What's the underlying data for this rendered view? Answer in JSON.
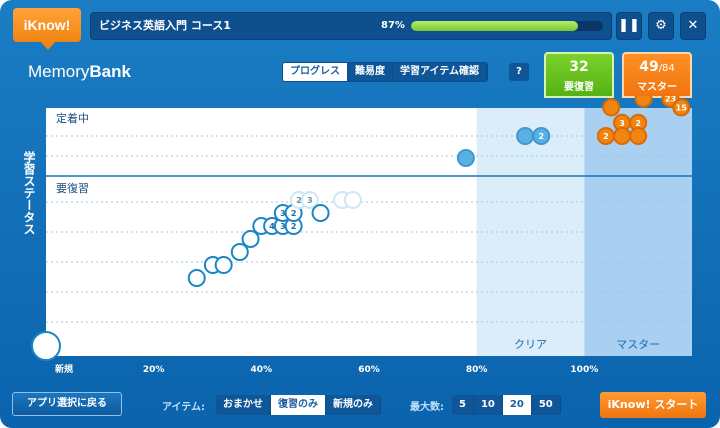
{
  "header": {
    "logo": "iKnow!",
    "course_title": "ビジネス英語入門 コース1",
    "progress_text": "87%",
    "progress_fraction": 0.87,
    "pause_icon": "pause-icon",
    "settings_icon": "gear-icon",
    "close_icon": "close-icon"
  },
  "panel": {
    "title_light": "Memory",
    "title_bold": "Bank",
    "tabs": [
      {
        "label": "プログレス",
        "active": true
      },
      {
        "label": "難易度",
        "active": false
      },
      {
        "label": "学習アイテム確認",
        "active": false
      }
    ],
    "help_label": "?",
    "review": {
      "count": "32",
      "label": "要復習"
    },
    "master": {
      "count": "49",
      "total": "/84",
      "label": "マスター"
    }
  },
  "chart_data": {
    "type": "scatter",
    "ylabel": "学習ステータス",
    "status_labels": [
      "定着中",
      "要復習"
    ],
    "x_ticks": [
      "新規",
      "20%",
      "40%",
      "60%",
      "80%",
      "100%"
    ],
    "zones": [
      {
        "label": "クリア",
        "from": 80,
        "to": 100
      },
      {
        "label": "マスター",
        "from": 100,
        "to": 120
      }
    ],
    "colors": {
      "plot_bg": "#ffffff",
      "clear_zone": "#dcedfa",
      "master_zone": "#a9d0f0",
      "review_ring": "#1a86c4",
      "review_faded": "#cfe6f6",
      "clear_point": "#5ab0e2",
      "master_point": "#f08512"
    },
    "points": [
      {
        "x": 0,
        "level": -6,
        "label": "",
        "style": "new"
      },
      {
        "x": 28,
        "level": -3.5,
        "label": "",
        "style": "review"
      },
      {
        "x": 31,
        "level": -3,
        "label": "",
        "style": "review"
      },
      {
        "x": 33,
        "level": -3,
        "label": "",
        "style": "review"
      },
      {
        "x": 36,
        "level": -2.5,
        "label": "",
        "style": "review"
      },
      {
        "x": 38,
        "level": -2,
        "label": "",
        "style": "review"
      },
      {
        "x": 40,
        "level": -1.5,
        "label": "",
        "style": "review"
      },
      {
        "x": 42,
        "level": -1.5,
        "label": "4",
        "style": "review"
      },
      {
        "x": 44,
        "level": -1.5,
        "label": "3",
        "style": "review"
      },
      {
        "x": 46,
        "level": -1.5,
        "label": "2",
        "style": "review"
      },
      {
        "x": 44,
        "level": -1,
        "label": "3",
        "style": "review"
      },
      {
        "x": 46,
        "level": -1,
        "label": "2",
        "style": "review"
      },
      {
        "x": 47,
        "level": -0.5,
        "label": "2",
        "style": "faded"
      },
      {
        "x": 49,
        "level": -0.5,
        "label": "3",
        "style": "faded"
      },
      {
        "x": 51,
        "level": -1,
        "label": "",
        "style": "review"
      },
      {
        "x": 55,
        "level": -0.5,
        "label": "",
        "style": "faded"
      },
      {
        "x": 57,
        "level": -0.5,
        "label": "",
        "style": "faded"
      },
      {
        "x": 78,
        "level": 0,
        "label": "",
        "style": "clear"
      },
      {
        "x": 89,
        "level": 1,
        "label": "",
        "style": "clear"
      },
      {
        "x": 92,
        "level": 1,
        "label": "2",
        "style": "clear"
      },
      {
        "x": 105,
        "level": 2.3,
        "label": "",
        "style": "master"
      },
      {
        "x": 111,
        "level": 2.7,
        "label": "",
        "style": "master"
      },
      {
        "x": 116,
        "level": 2.7,
        "label": "23",
        "style": "master"
      },
      {
        "x": 118,
        "level": 2.3,
        "label": "15",
        "style": "master"
      },
      {
        "x": 107,
        "level": 1.6,
        "label": "3",
        "style": "master"
      },
      {
        "x": 110,
        "level": 1.6,
        "label": "2",
        "style": "master"
      },
      {
        "x": 104,
        "level": 1,
        "label": "2",
        "style": "master"
      },
      {
        "x": 107,
        "level": 1,
        "label": "",
        "style": "master"
      },
      {
        "x": 110,
        "level": 1,
        "label": "",
        "style": "master"
      }
    ]
  },
  "footer": {
    "back_label": "アプリ選択に戻る",
    "item_label": "アイテム:",
    "item_options": [
      {
        "label": "おまかせ",
        "active": false
      },
      {
        "label": "復習のみ",
        "active": true
      },
      {
        "label": "新規のみ",
        "active": false
      }
    ],
    "max_label": "最大数:",
    "max_options": [
      {
        "label": "5",
        "active": false
      },
      {
        "label": "10",
        "active": false
      },
      {
        "label": "20",
        "active": true
      },
      {
        "label": "50",
        "active": false
      }
    ],
    "start_label": "iKnow! スタート"
  }
}
